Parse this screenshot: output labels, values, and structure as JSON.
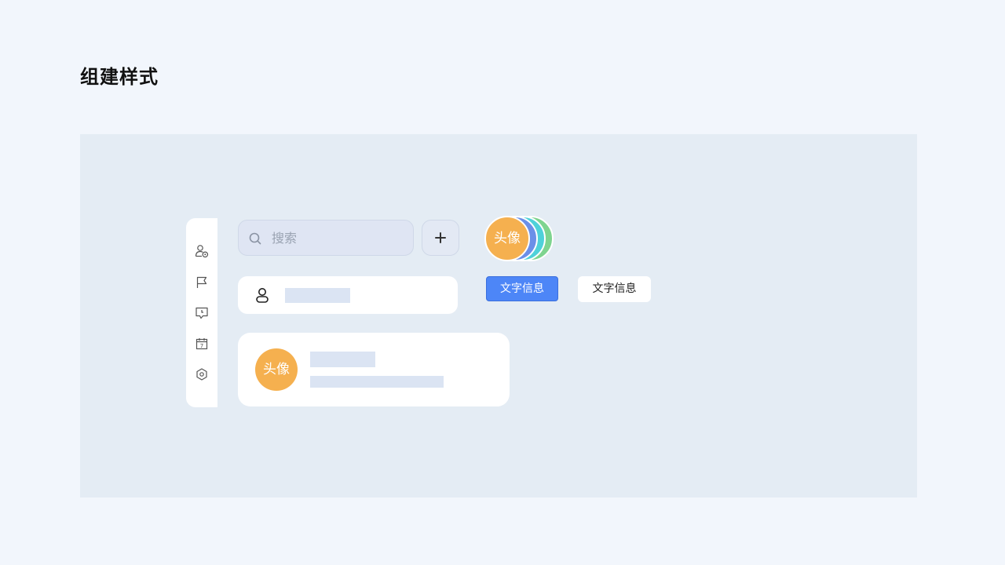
{
  "page": {
    "title": "组建样式"
  },
  "sidebar": {
    "items": [
      {
        "icon": "user-settings-icon"
      },
      {
        "icon": "flag-icon"
      },
      {
        "icon": "message-clock-icon"
      },
      {
        "icon": "calendar-icon",
        "day": "7"
      },
      {
        "icon": "hexagon-settings-icon"
      }
    ]
  },
  "search": {
    "placeholder": "搜索",
    "value": ""
  },
  "add_button": {
    "icon": "plus-icon"
  },
  "user_row": {
    "icon": "user-icon"
  },
  "card": {
    "avatar_label": "头像"
  },
  "avatar_stack": {
    "front_label": "头像",
    "colors": [
      "#7ed48f",
      "#4fd1d9",
      "#6b8fe8",
      "#f5b04f"
    ]
  },
  "tags": {
    "primary_label": "文字信息",
    "default_label": "文字信息"
  },
  "colors": {
    "background": "#f2f6fc",
    "panel": "#e4ecf4",
    "accent": "#4d86f7",
    "avatar": "#f5b04f",
    "placeholder_bar": "#dbe4f3"
  }
}
